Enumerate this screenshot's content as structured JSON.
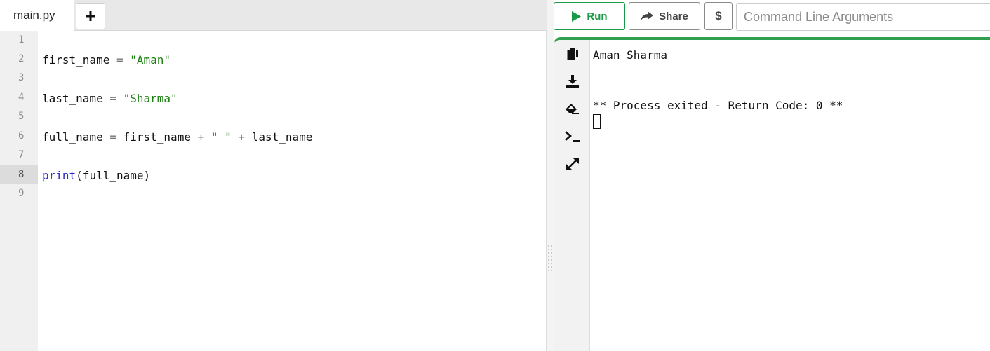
{
  "editor": {
    "tab_label": "main.py",
    "add_tab_label": "+",
    "line_numbers": [
      "1",
      "2",
      "3",
      "4",
      "5",
      "6",
      "7",
      "8",
      "9"
    ],
    "active_line": "8",
    "code": {
      "l2": {
        "name": "first_name",
        "op": "=",
        "value": "\"Aman\""
      },
      "l4": {
        "name": "last_name",
        "op": "=",
        "value": "\"Sharma\""
      },
      "l6": {
        "name": "full_name",
        "op": "=",
        "a": "first_name",
        "plus1": "+",
        "space": "\" \"",
        "plus2": "+",
        "b": "last_name"
      },
      "l8": {
        "fn": "print",
        "args": "(full_name)"
      }
    }
  },
  "toolbar": {
    "run_label": "Run",
    "share_label": "Share",
    "dollar_label": "$",
    "args_placeholder": "Command Line Arguments"
  },
  "output": {
    "lines": [
      "Aman Sharma",
      "",
      "",
      "** Process exited - Return Code: 0 **"
    ],
    "tools": [
      "copy-icon",
      "download-icon",
      "eraser-icon",
      "terminal-icon",
      "expand-icon"
    ]
  },
  "colors": {
    "accent_green": "#1a9a46",
    "string_green": "#1a7f0e",
    "keyword_blue": "#2a2acc"
  }
}
